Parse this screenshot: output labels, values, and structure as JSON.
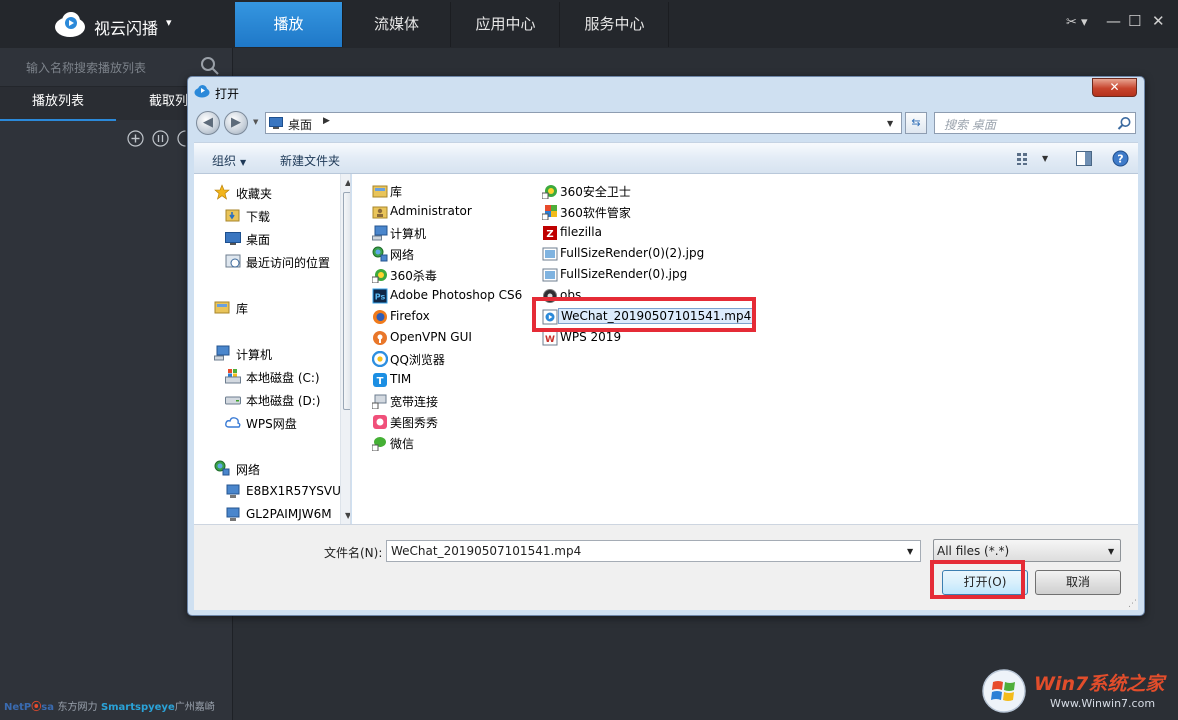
{
  "app": {
    "title": "视云闪播",
    "caret": "▾",
    "tabs": [
      {
        "label": "播放",
        "active": true
      },
      {
        "label": "流媒体"
      },
      {
        "label": "应用中心"
      },
      {
        "label": "服务中心"
      }
    ],
    "window_controls": {
      "skin": "✂ ▾",
      "minimize": "—",
      "maximize": "☐",
      "close": "✕"
    },
    "search_placeholder": "输入名称搜索播放列表",
    "left_tabs": [
      "播放列表",
      "截取列"
    ],
    "brand": {
      "a": "NetP",
      "b": "sa",
      "c": "东方网力",
      "d": "Smartspyeye",
      "e": "广州嘉崎"
    },
    "accent": "#2b89d9"
  },
  "dialog": {
    "title": "打开",
    "close": "✕",
    "back": "◀",
    "forward": "▶",
    "address": "桌面",
    "address_chevron": "▶",
    "refresh": "⇆",
    "search_placeholder": "搜索 桌面",
    "commands": {
      "organize": "组织",
      "new_folder": "新建文件夹"
    },
    "nav": {
      "favorites": "收藏夹",
      "downloads": "下载",
      "desktop": "桌面",
      "recent": "最近访问的位置",
      "libraries": "库",
      "computer": "计算机",
      "drive_c": "本地磁盘 (C:)",
      "drive_d": "本地磁盘 (D:)",
      "wps_cloud": "WPS网盘",
      "network": "网络",
      "host1": "E8BX1R57YSVU",
      "host2": "GL2PAIMJW6M"
    },
    "files_col1": [
      "库",
      "Administrator",
      "计算机",
      "网络",
      "360杀毒",
      "Adobe Photoshop CS6",
      "Firefox",
      "OpenVPN GUI",
      "QQ浏览器",
      "TIM",
      "宽带连接",
      "美图秀秀",
      "微信"
    ],
    "files_col2": [
      "360安全卫士",
      "360软件管家",
      "filezilla",
      "FullSizeRender(0)(2).jpg",
      "FullSizeRender(0).jpg",
      "obs",
      "WeChat_20190507101541.mp4",
      "WPS 2019"
    ],
    "filename_label": "文件名(N):",
    "filename_value": "WeChat_20190507101541.mp4",
    "filetype": "All files (*.*)",
    "open_button": "打开(O)",
    "cancel_button": "取消",
    "highlight_color": "#e52b36"
  },
  "watermark": {
    "main": "Win7系统之家",
    "url": "Www.Winwin7.com"
  }
}
